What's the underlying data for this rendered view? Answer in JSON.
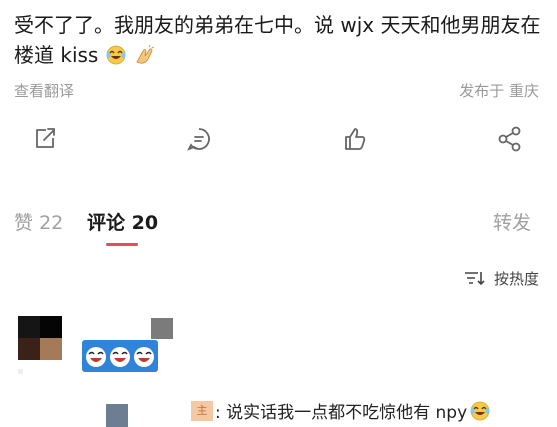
{
  "post": {
    "text": "受不了了。我朋友的弟弟在七中。说 wjx 天天和他男朋友在楼道 kiss",
    "emojis": [
      "crying-laughing-emoji",
      "clapping-hands-emoji"
    ],
    "translate_label": "查看翻译",
    "location_label": "发布于 重庆"
  },
  "actions": {
    "icons": [
      "share-out-icon",
      "comment-icon",
      "thumbs-up-icon",
      "share-network-icon"
    ]
  },
  "tabs": {
    "likes_label": "赞",
    "likes_count": "22",
    "comments_label": "评论",
    "comments_count": "20",
    "forward_label": "转发",
    "active_color": "#e84a5f"
  },
  "sort": {
    "label": "按热度",
    "icon": "sort-icon"
  },
  "comment": {
    "stickers": [
      "crying-laughing-sticker"
    ]
  },
  "reply": {
    "badge": "主",
    "text": ": 说实话我一点都不吃惊他有 npy"
  }
}
